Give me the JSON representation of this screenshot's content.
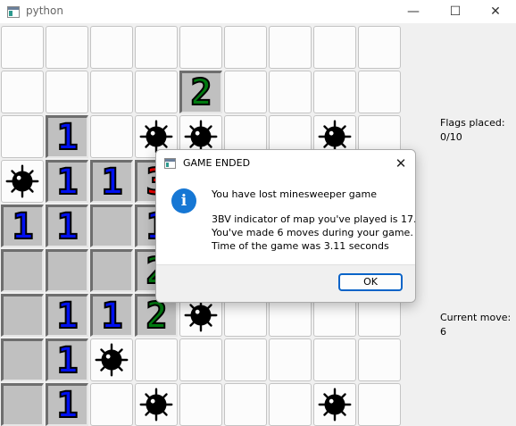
{
  "window": {
    "title": "python",
    "icon": "python-app-icon",
    "minimize_glyph": "—",
    "maximize_glyph": "☐",
    "close_glyph": "✕"
  },
  "board": {
    "cols": 9,
    "rows": 9,
    "cells": [
      [
        "c",
        "c",
        "c",
        "c",
        "c",
        "c",
        "c",
        "c",
        "c"
      ],
      [
        "c",
        "c",
        "c",
        "c",
        "2",
        "c",
        "c",
        "c",
        "c"
      ],
      [
        "c",
        "1",
        "c",
        "b",
        "b",
        "c",
        "c",
        "b",
        "c"
      ],
      [
        "b",
        "1",
        "1",
        "3",
        "c",
        "c",
        "c",
        "c",
        "c"
      ],
      [
        "1",
        "1",
        "o",
        "1",
        "c",
        "c",
        "c",
        "c",
        "c"
      ],
      [
        "o",
        "o",
        "o",
        "2",
        "c",
        "c",
        "c",
        "c",
        "c"
      ],
      [
        "o",
        "1",
        "1",
        "2",
        "b",
        "c",
        "c",
        "c",
        "c"
      ],
      [
        "o",
        "1",
        "b",
        "c",
        "c",
        "c",
        "c",
        "c",
        "c"
      ],
      [
        "o",
        "1",
        "c",
        "b",
        "c",
        "c",
        "c",
        "b",
        "c"
      ]
    ]
  },
  "side": {
    "flags_label": "Flags placed:",
    "flags_value": "0/10",
    "move_label": "Current move:",
    "move_value": "6"
  },
  "dialog": {
    "title": "GAME ENDED",
    "close_glyph": "✕",
    "info_glyph": "i",
    "line1": "You have lost minesweeper game",
    "line2": "3BV indicator of map you've played is 17.",
    "line3": "You've made 6 moves during your game.",
    "line4": "Time of the game was 3.11 seconds",
    "ok_label": "OK"
  },
  "colors": {
    "one": "#0010f0",
    "two": "#007a10",
    "three": "#ee0000",
    "info": "#1677d4",
    "button_border": "#0a64c8"
  }
}
